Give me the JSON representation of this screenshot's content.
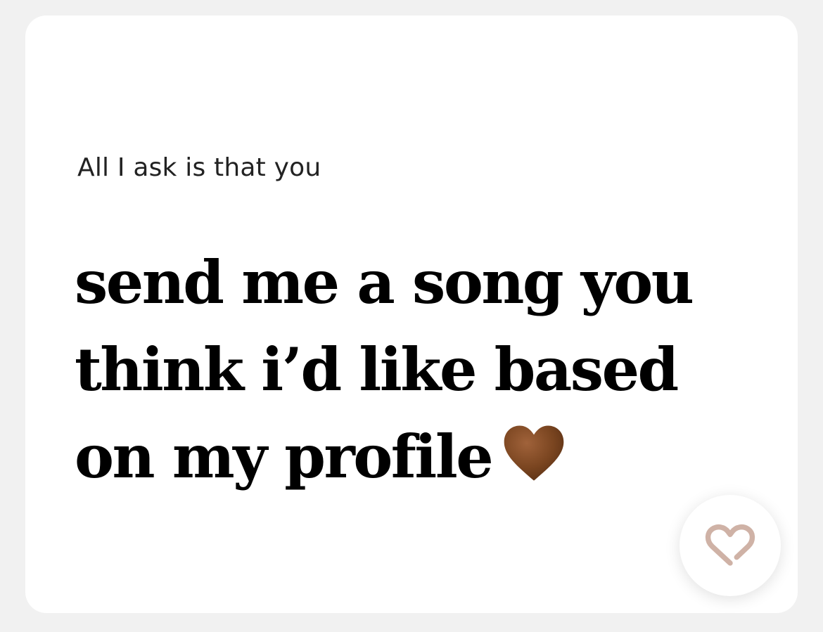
{
  "prompt_card": {
    "question": "All I ask is that you",
    "answer": "send me a song you think i’d like based on my profile",
    "answer_emoji_icon": "brown-heart-icon",
    "like_button_icon": "heart-outline-icon",
    "colors": {
      "background": "#f1f1f1",
      "card": "#ffffff",
      "emoji_heart": "#7a4520",
      "like_icon": "#cfb2a6"
    }
  }
}
